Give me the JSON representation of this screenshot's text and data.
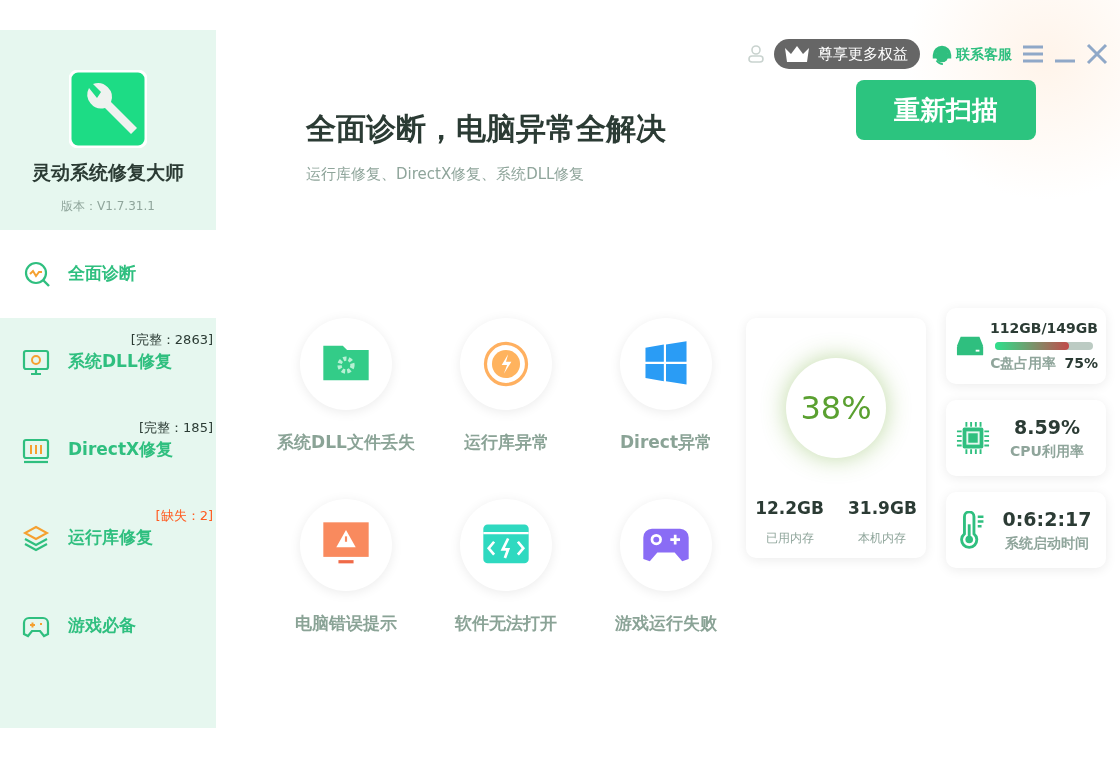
{
  "app": {
    "name": "灵动系统修复大师",
    "version": "版本：V1.7.31.1"
  },
  "sidebar": {
    "items": [
      {
        "kind": "scan",
        "label": "全面诊断",
        "selected": true
      },
      {
        "kind": "monitor",
        "label": "系统DLL修复",
        "selected": false,
        "badge": {
          "text": "[完整：2863]",
          "color": "#2b3b34"
        }
      },
      {
        "kind": "directx",
        "label": "DirectX修复",
        "selected": false,
        "badge": {
          "text": "[完整：185]",
          "color": "#2b3b34"
        }
      },
      {
        "kind": "layers",
        "label": "运行库修复",
        "selected": false,
        "badge": {
          "text": "[缺失：2]",
          "color": "#ff5a1f"
        }
      },
      {
        "kind": "gamepad",
        "label": "游戏必备",
        "selected": false
      }
    ]
  },
  "topbar": {
    "vip": "尊享更多权益",
    "support": "联系客服"
  },
  "hero": {
    "title": "全面诊断，电脑异常全解决",
    "subtitle": "运行库修复、DirectX修复、系统DLL修复",
    "button": "重新扫描"
  },
  "tiles": [
    {
      "kind": "folder",
      "label": "系统DLL文件丢失"
    },
    {
      "kind": "power",
      "label": "运行库异常"
    },
    {
      "kind": "windows",
      "label": "Direct异常"
    },
    {
      "kind": "monitor",
      "label": "电脑错误提示"
    },
    {
      "kind": "code",
      "label": "软件无法打开"
    },
    {
      "kind": "gamepad",
      "label": "游戏运行失败"
    }
  ],
  "memory": {
    "percent": "38%",
    "used": "12.2GB",
    "used_label": "已用内存",
    "total": "31.9GB",
    "total_label": "本机内存"
  },
  "stats": [
    {
      "kind": "disk",
      "value": "112GB/149GB",
      "level": 0.75,
      "label": "C盘占用率",
      "reading": "75%"
    },
    {
      "kind": "cpu",
      "value": "8.59%",
      "label": "CPU利用率"
    },
    {
      "kind": "uptime",
      "value": "0:6:2:17",
      "label": "系统启动时间"
    }
  ]
}
